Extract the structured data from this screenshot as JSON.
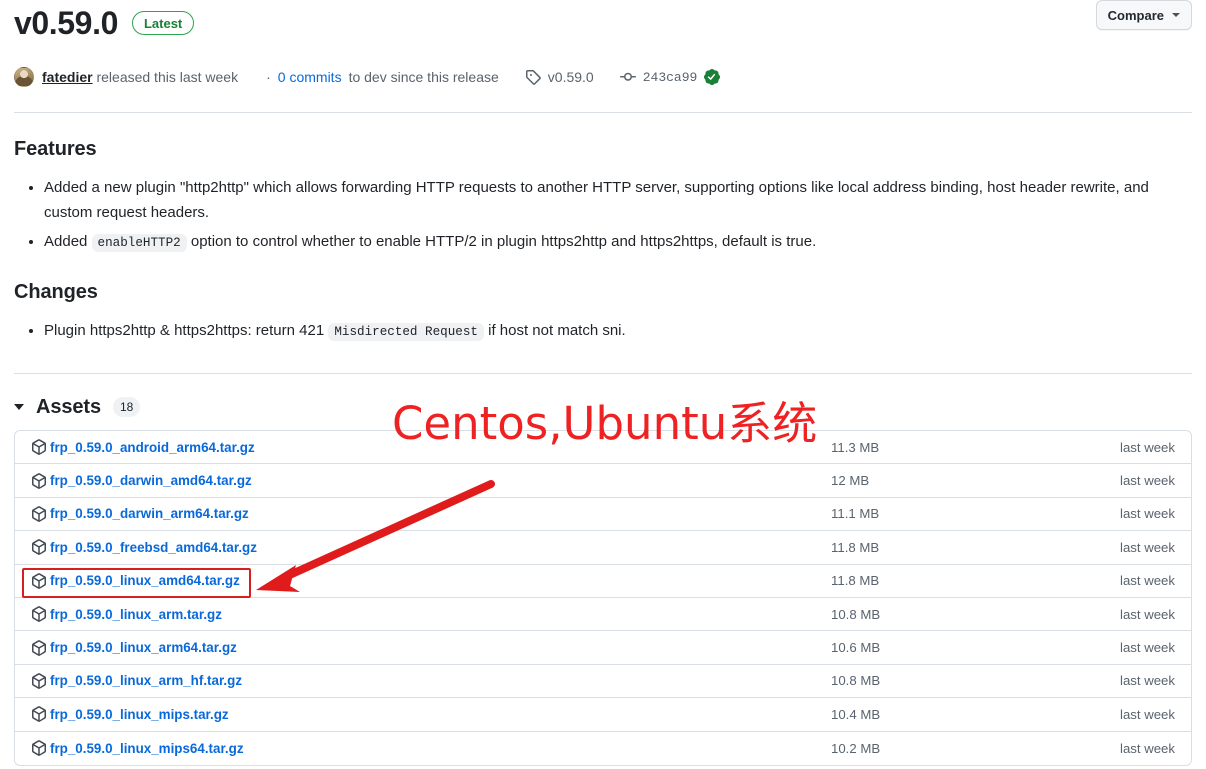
{
  "header": {
    "version": "v0.59.0",
    "latest_badge": "Latest",
    "compare_label": "Compare",
    "compare_caret_icon": "chevron-down-icon"
  },
  "meta": {
    "avatar_icon": "user-avatar",
    "author": "fatedier",
    "released_text": "released this last week",
    "commits_prefix": "·",
    "commits_link": "0 commits",
    "commits_suffix": "to dev since this release",
    "tag_icon": "tag-icon",
    "tag_name": "v0.59.0",
    "commit_icon": "git-commit-icon",
    "commit_sha": "243ca99",
    "verified_icon": "verified-check-icon"
  },
  "features": {
    "heading": "Features",
    "items": [
      {
        "pre": "Added a new plugin \"http2http\" which allows forwarding HTTP requests to another HTTP server, supporting options like local address binding, host header rewrite, and custom request headers.",
        "code": "",
        "post": ""
      },
      {
        "pre": "Added ",
        "code": "enableHTTP2",
        "post": " option to control whether to enable HTTP/2 in plugin https2http and https2https, default is true."
      }
    ]
  },
  "changes": {
    "heading": "Changes",
    "items": [
      {
        "pre": "Plugin https2http & https2https: return 421 ",
        "code": "Misdirected Request",
        "post": " if host not match sni."
      }
    ]
  },
  "assets": {
    "disclosure_icon": "triangle-down-icon",
    "label": "Assets",
    "count": "18",
    "package_icon": "package-icon",
    "rows": [
      {
        "name": "frp_0.59.0_android_arm64.tar.gz",
        "size": "11.3 MB",
        "date": "last week"
      },
      {
        "name": "frp_0.59.0_darwin_amd64.tar.gz",
        "size": "12 MB",
        "date": "last week"
      },
      {
        "name": "frp_0.59.0_darwin_arm64.tar.gz",
        "size": "11.1 MB",
        "date": "last week"
      },
      {
        "name": "frp_0.59.0_freebsd_amd64.tar.gz",
        "size": "11.8 MB",
        "date": "last week"
      },
      {
        "name": "frp_0.59.0_linux_amd64.tar.gz",
        "size": "11.8 MB",
        "date": "last week"
      },
      {
        "name": "frp_0.59.0_linux_arm.tar.gz",
        "size": "10.8 MB",
        "date": "last week"
      },
      {
        "name": "frp_0.59.0_linux_arm64.tar.gz",
        "size": "10.6 MB",
        "date": "last week"
      },
      {
        "name": "frp_0.59.0_linux_arm_hf.tar.gz",
        "size": "10.8 MB",
        "date": "last week"
      },
      {
        "name": "frp_0.59.0_linux_mips.tar.gz",
        "size": "10.4 MB",
        "date": "last week"
      },
      {
        "name": "frp_0.59.0_linux_mips64.tar.gz",
        "size": "10.2 MB",
        "date": "last week"
      }
    ]
  },
  "annotation": {
    "text": "Centos,Ubuntu系统",
    "text_color": "#ee2222",
    "arrow_color": "#e01b1b",
    "highlight_box_color": "#d81f1f",
    "highlight_target": "frp_0.59.0_linux_amd64.tar.gz"
  },
  "colors": {
    "link": "#0969da",
    "muted": "#59636e",
    "text": "#1f2328",
    "border": "#d8dee4",
    "green": "#1a7f37"
  }
}
